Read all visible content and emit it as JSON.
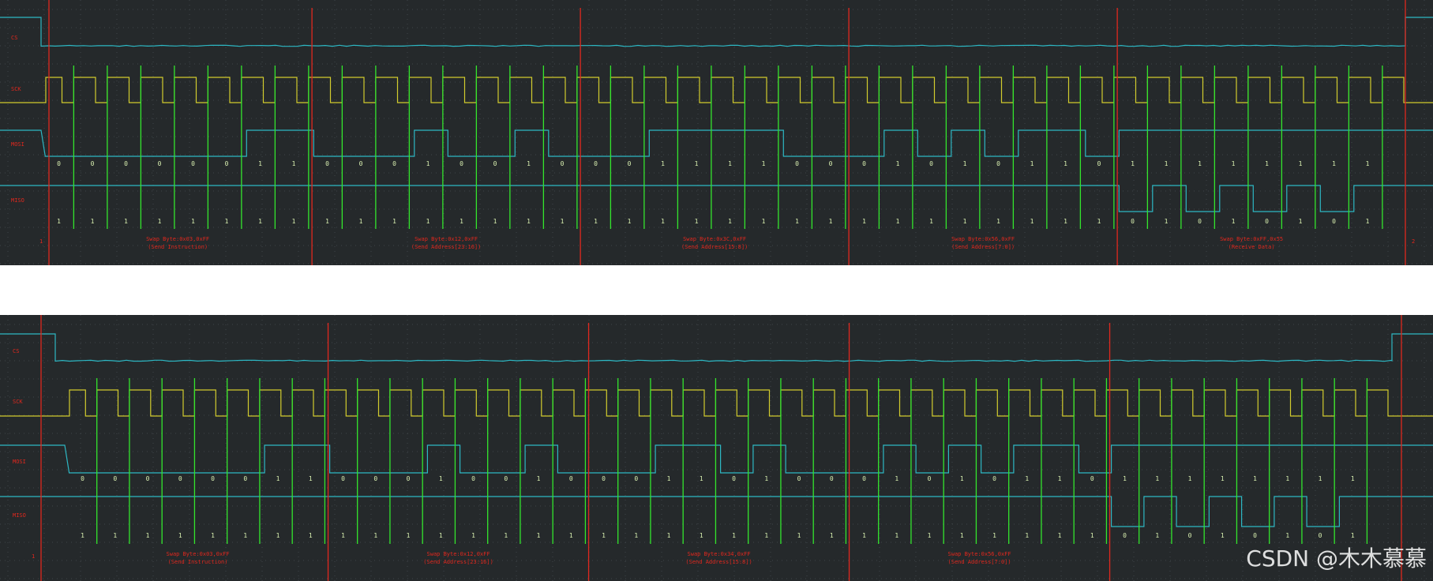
{
  "panels": [
    {
      "id": "top",
      "channels": [
        "CS",
        "SCK",
        "MOSI",
        "MISO"
      ],
      "mosi_bits": [
        0,
        0,
        0,
        0,
        0,
        0,
        1,
        1,
        0,
        0,
        0,
        1,
        0,
        0,
        1,
        0,
        0,
        0,
        1,
        1,
        1,
        1,
        0,
        0,
        0,
        1,
        0,
        1,
        0,
        1,
        1,
        0,
        1,
        1,
        1,
        1,
        1,
        1,
        1,
        1
      ],
      "miso_bits": [
        1,
        1,
        1,
        1,
        1,
        1,
        1,
        1,
        1,
        1,
        1,
        1,
        1,
        1,
        1,
        1,
        1,
        1,
        1,
        1,
        1,
        1,
        1,
        1,
        1,
        1,
        1,
        1,
        1,
        1,
        1,
        1,
        0,
        1,
        0,
        1,
        0,
        1,
        0,
        1
      ],
      "annotations": [
        {
          "line1": "Swap Byte:0x03,0xFF",
          "line2": "(Send Instruction)"
        },
        {
          "line1": "Swap Byte:0x12,0xFF",
          "line2": "(Send Address[23:16])"
        },
        {
          "line1": "Swap Byte:0x3C,0xFF",
          "line2": "(Send Address[15:8])"
        },
        {
          "line1": "Swap Byte:0x56,0xFF",
          "line2": "(Send Address[7:0])"
        },
        {
          "line1": "Swap Byte:0xFF,0x55",
          "line2": "(Receive Data)"
        }
      ],
      "end_markers": [
        "1",
        "2"
      ]
    },
    {
      "id": "bottom",
      "channels": [
        "CS",
        "SCK",
        "MOSI",
        "MISO"
      ],
      "mosi_bits": [
        0,
        0,
        0,
        0,
        0,
        0,
        1,
        1,
        0,
        0,
        0,
        1,
        0,
        0,
        1,
        0,
        0,
        0,
        1,
        1,
        0,
        1,
        0,
        0,
        0,
        1,
        0,
        1,
        0,
        1,
        1,
        0,
        1,
        1,
        1,
        1,
        1,
        1,
        1,
        1
      ],
      "miso_bits": [
        1,
        1,
        1,
        1,
        1,
        1,
        1,
        1,
        1,
        1,
        1,
        1,
        1,
        1,
        1,
        1,
        1,
        1,
        1,
        1,
        1,
        1,
        1,
        1,
        1,
        1,
        1,
        1,
        1,
        1,
        1,
        1,
        0,
        1,
        0,
        1,
        0,
        1,
        0,
        1
      ],
      "annotations": [
        {
          "line1": "Swap Byte:0x03,0xFF",
          "line2": "(Send Instruction)"
        },
        {
          "line1": "Swap Byte:0x12,0xFF",
          "line2": "(Send Address[23:16])"
        },
        {
          "line1": "Swap Byte:0x34,0xFF",
          "line2": "(Send Address[15:8])"
        },
        {
          "line1": "Swap Byte:0x56,0xFF",
          "line2": "(Send Address[7:0])"
        },
        {
          "line1": "",
          "line2": ""
        }
      ],
      "end_markers": [
        "1",
        ""
      ]
    }
  ],
  "watermark": "CSDN @木木慕慕",
  "colors": {
    "background": "#25292b",
    "grid": "#3e4548",
    "cursor": "#e0281e",
    "clock": "#d2cc2e",
    "data": "#2db7c3",
    "sample": "#33e52d"
  }
}
